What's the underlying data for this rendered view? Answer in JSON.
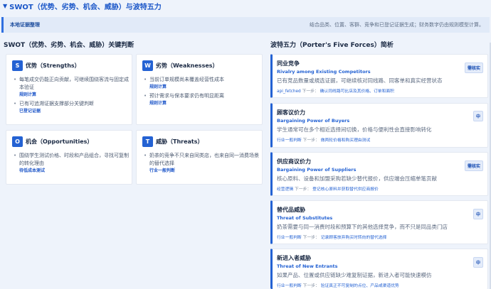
{
  "header": {
    "title": "SWOT（优势、劣势、机会、威胁）与波特五力"
  },
  "banner": {
    "tag": "本地证据整理",
    "desc": "结合品类、位置、客群、竞争和已登记证据生成；财务数字仍由规则模型计算。"
  },
  "swot": {
    "heading": "SWOT（优势、劣势、机会、威胁）关键判断",
    "cards": [
      {
        "letter": "S",
        "title": "优势（Strengths）",
        "groups": [
          {
            "text": "每笔成交仍能正向贡献，可继续围绕客流与固定成本验证",
            "source": "规则计算"
          },
          {
            "text": "已有可追溯证据支撑部分关键判断",
            "source": "已登记证据"
          }
        ]
      },
      {
        "letter": "W",
        "title": "劣势（Weaknesses）",
        "groups": [
          {
            "text": "当前订单规模尚未覆盖经营性成本",
            "source": "规则计算"
          },
          {
            "text": "预计需求与保本要求仍有明显距离",
            "source": "规则计算"
          }
        ]
      },
      {
        "letter": "O",
        "title": "机会（Opportunities）",
        "groups": [
          {
            "text": "围绕学生测试价格、时段和产品组合，寻找可复制的转化理由",
            "source": "待低成本测试"
          }
        ]
      },
      {
        "letter": "T",
        "title": "威胁（Threats）",
        "groups": [
          {
            "text": "奶茶的竞争不只来自同类店，也来自同一消费场景的替代选择",
            "source": "行业一般判断"
          }
        ]
      }
    ]
  },
  "five_forces": {
    "heading": "波特五力（Porter's Five Forces）简析",
    "next_label": "下一步：",
    "forces": [
      {
        "title": "同业竞争",
        "subtitle": "Rivalry among Existing Competitors",
        "desc": "已有竞品数量或規选证据，可继续核对同线路、同客单和真实经营状态",
        "source": "api_fetched",
        "next": "确认同线路可比店及其价格、订单和面积",
        "level": "需核实"
      },
      {
        "title": "顾客议价力",
        "subtitle": "Bargaining Power of Buyers",
        "desc": "学生通常可在多个相近选择间切换，价格与便利性会直接影响转化",
        "source": "行业一般判断",
        "next": "做两轮价格和购买理由测试",
        "level": "中"
      },
      {
        "title": "供应商议价力",
        "subtitle": "Bargaining Power of Suppliers",
        "desc": "核心原料、设备和加盟采购若缺少替代报价，供应端会压缩单笔贡献",
        "source": "经营逻辑",
        "next": "登记核心原料并获取替代供应商报价",
        "level": "需核实"
      },
      {
        "title": "替代品威胁",
        "subtitle": "Threat of Substitutes",
        "desc": "奶茶需要与同一消费时段和预算下的其他选择竞争，而不只是同品类门店",
        "source": "行业一般判断",
        "next": "记录顾客放弃购买时转向的替代选择",
        "level": "中"
      },
      {
        "title": "新进入者威胁",
        "subtitle": "Threat of New Entrants",
        "desc": "如果产品、位置或供应链缺少难复制证据，新进入者可能快速模仿",
        "source": "行业一般判断",
        "next": "验证真正不可复制的点位、产品或渠道优势",
        "level": "中"
      }
    ]
  }
}
